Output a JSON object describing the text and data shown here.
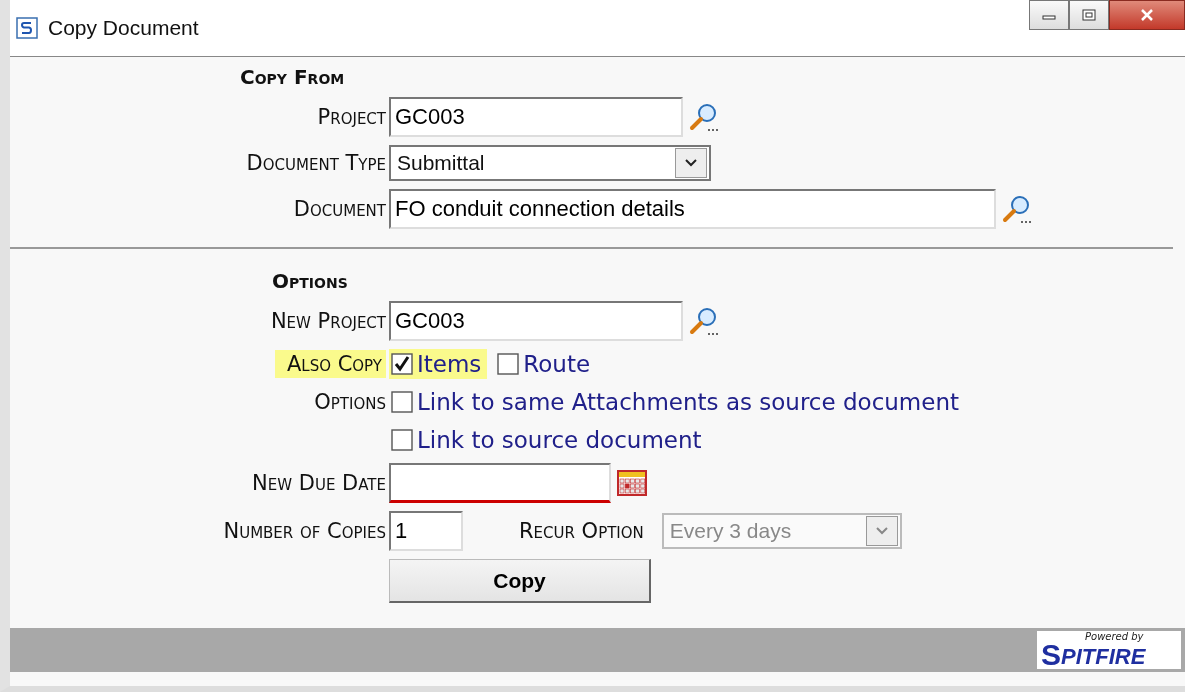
{
  "window": {
    "title": "Copy Document"
  },
  "copy_from": {
    "heading": "Copy From",
    "project": {
      "label": "Project",
      "value": "GC003"
    },
    "document_type": {
      "label": "Document Type",
      "value": "Submittal"
    },
    "document": {
      "label": "Document",
      "value": "FO conduit connection details"
    }
  },
  "options": {
    "heading": "Options",
    "new_project": {
      "label": "New Project",
      "value": "GC003"
    },
    "also_copy": {
      "label": "Also Copy",
      "highlighted": true,
      "items": [
        {
          "label": "Items",
          "checked": true,
          "highlighted": true
        },
        {
          "label": "Route",
          "checked": false,
          "highlighted": false
        }
      ]
    },
    "options_label": "Options",
    "option_items": [
      {
        "label": "Link to same Attachments as source document",
        "checked": false
      },
      {
        "label": "Link to source document",
        "checked": false
      }
    ],
    "new_due_date": {
      "label": "New Due Date",
      "invalid": true
    },
    "number_of_copies": {
      "label": "Number of Copies",
      "value": "1"
    },
    "recur_option": {
      "label": "Recur Option",
      "value": "Every 3 days",
      "disabled": true
    },
    "copy_button": "Copy"
  },
  "footer": {
    "powered_by": "Powered by",
    "brand_initial": "S",
    "brand_rest": "PITFIRE"
  }
}
